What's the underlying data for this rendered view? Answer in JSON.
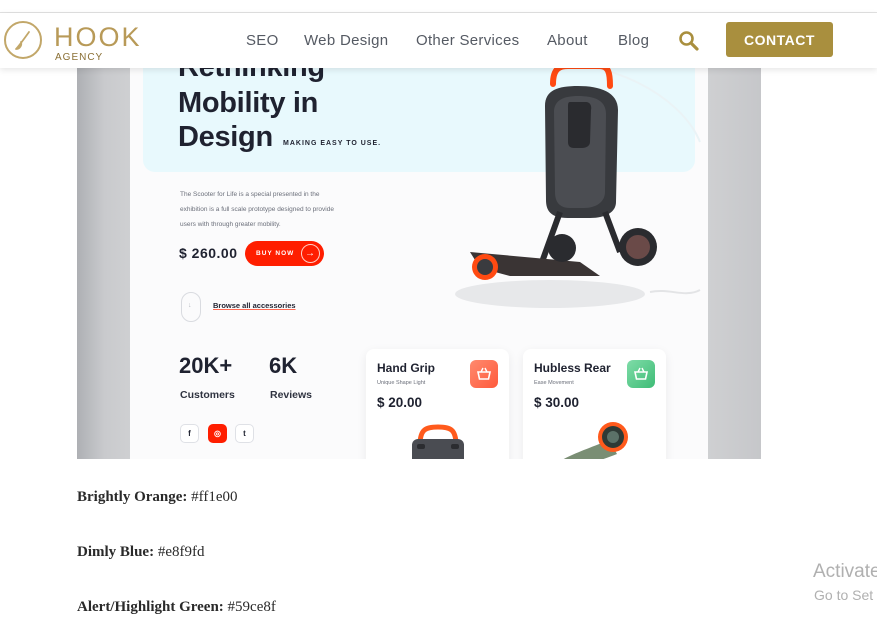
{
  "header": {
    "logo_main": "HOOK",
    "logo_sub": "AGENCY",
    "nav": [
      "SEO",
      "Web Design",
      "Other Services",
      "About",
      "Blog"
    ],
    "search_icon": "search-icon",
    "contact_label": "CONTACT",
    "accent_color": "#a98f3e"
  },
  "hero": {
    "heading_line1": "Rethinking",
    "heading_line2": "Mobility in",
    "heading_line3": "Design",
    "tagline": "MAKING EASY TO USE.",
    "desc_line1": "The Scooter for Life is a special presented in the",
    "desc_line2": "exhibition is a full scale prototype designed to provide",
    "desc_line3": "users with through greater mobility.",
    "price": "$ 260.00",
    "buy_label": "BUY NOW",
    "browse_label": "Browse all accessories",
    "stats": [
      {
        "num": "20K+",
        "label": "Customers"
      },
      {
        "num": "6K",
        "label": "Reviews"
      }
    ],
    "social": [
      "f",
      "◎",
      "t"
    ],
    "products": [
      {
        "name": "Hand Grip",
        "sub": "Unique Shape Light",
        "price": "$ 20.00",
        "button_color": "#ff6b55"
      },
      {
        "name": "Hubless Rear",
        "sub": "Ease Movement",
        "price": "$ 30.00",
        "button_color": "#59ce8f"
      }
    ]
  },
  "colors": [
    {
      "label": "Brightly Orange:",
      "value": "#ff1e00"
    },
    {
      "label": "Dimly Blue:",
      "value": "#e8f9fd"
    },
    {
      "label": "Alert/Highlight Green:",
      "value": "#59ce8f"
    }
  ],
  "watermark": {
    "line1": "Activate",
    "line2": "Go to Set"
  }
}
